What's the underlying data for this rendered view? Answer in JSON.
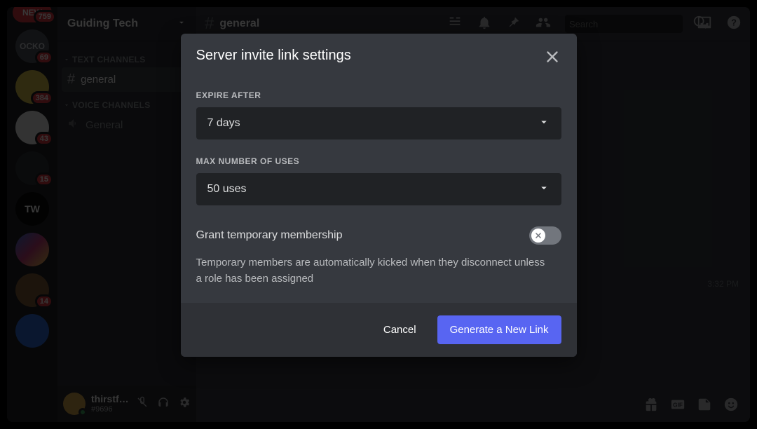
{
  "server_list": {
    "new_badge": "NEW",
    "new_count": "759",
    "items": [
      {
        "label": "OCKO",
        "count": "69"
      },
      {
        "label": "",
        "count": "384"
      },
      {
        "label": "",
        "count": "43"
      },
      {
        "label": "",
        "count": "15"
      },
      {
        "label": "TW",
        "count": ""
      },
      {
        "label": "",
        "count": ""
      },
      {
        "label": "",
        "count": "14"
      },
      {
        "label": "",
        "count": ""
      }
    ]
  },
  "guild": {
    "name": "Guiding Tech"
  },
  "channels": {
    "cat_text": "TEXT CHANNELS",
    "cat_voice": "VOICE CHANNELS",
    "text_general": "general",
    "voice_general": "General"
  },
  "topbar": {
    "channel": "general",
    "search_placeholder": "Search"
  },
  "user": {
    "name": "thirstforle...",
    "tag": "#9696"
  },
  "timestamp": "3:32 PM",
  "modal": {
    "title": "Server invite link settings",
    "expire_label": "EXPIRE AFTER",
    "expire_value": "7 days",
    "uses_label": "MAX NUMBER OF USES",
    "uses_value": "50 uses",
    "temp_label": "Grant temporary membership",
    "temp_help": "Temporary members are automatically kicked when they disconnect unless a role has been assigned",
    "cancel": "Cancel",
    "generate": "Generate a New Link"
  }
}
